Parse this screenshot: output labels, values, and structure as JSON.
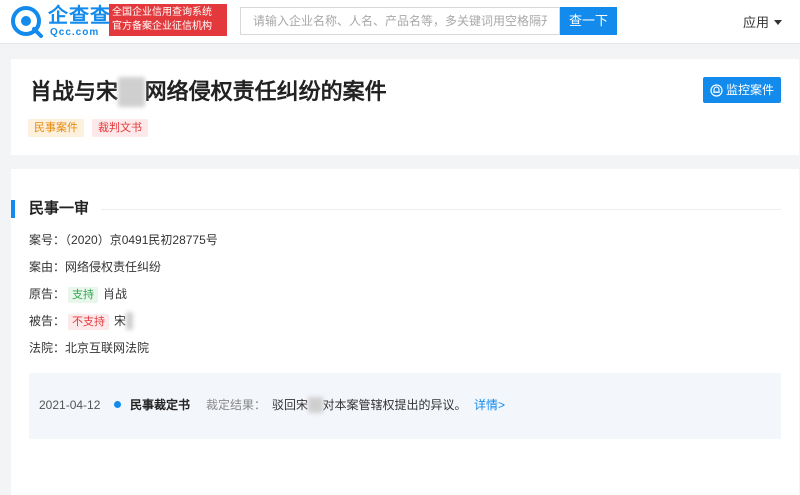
{
  "header": {
    "logo_text": "企查查",
    "logo_sub": "Qcc.com",
    "badge_line1": "全国企业信用查询系统",
    "badge_line2": "官方备案企业征信机构",
    "search_placeholder": "请输入企业名称、人名、产品名等，多关键词用空格隔开",
    "search_button": "查一下",
    "app_menu": "应用",
    "brand_color": "#128bed",
    "badge_color": "#e4393c"
  },
  "case": {
    "title_prefix": "肖战与宋",
    "title_redacted": "■■",
    "title_suffix": "网络侵权责任纠纷的案件",
    "tags": [
      "民事案件",
      "裁判文书"
    ],
    "monitor_button": "监控案件"
  },
  "section": {
    "title": "民事一审",
    "case_no_label": "案号：",
    "case_no": "（2020）京0491民初28775号",
    "cause_label": "案由：",
    "cause": "网络侵权责任纠纷",
    "plaintiff_label": "原告：",
    "plaintiff_tag": "支持",
    "plaintiff": "肖战",
    "defendant_label": "被告：",
    "defendant_tag": "不支持",
    "defendant": "宋",
    "defendant_redacted": "■",
    "court_label": "法院：",
    "court": "北京互联网法院"
  },
  "timeline": {
    "date": "2021-04-12",
    "type": "民事裁定书",
    "result_label": "裁定结果：",
    "result_prefix": "驳回宋",
    "result_redacted": "■■",
    "result_suffix": "对本案管辖权提出的异议。",
    "more": "详情>"
  }
}
